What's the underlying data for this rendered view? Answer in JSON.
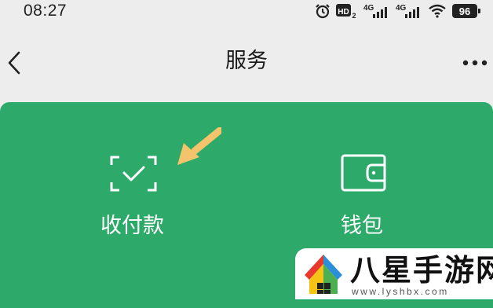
{
  "status_bar": {
    "time": "08:27",
    "icons": [
      "alarm-icon",
      "hd-icon",
      "signal-4g-icon",
      "signal-4g-icon",
      "wifi-icon",
      "battery-icon"
    ],
    "hd_label": "HD",
    "hd_sub": "2",
    "network_label": "4G",
    "battery": "96"
  },
  "nav": {
    "title": "服务",
    "back_icon": "chevron-left-icon",
    "more_icon": "more-dots-icon"
  },
  "services": {
    "background_color": "#2daa6a",
    "items": [
      {
        "label": "收付款",
        "icon": "scan-check-icon"
      },
      {
        "label": "钱包",
        "icon": "wallet-icon"
      }
    ],
    "pointer_icon": "arrow-pointer-icon",
    "pointer_color": "#f3c46b"
  },
  "watermark": {
    "title": "八星手游网",
    "domain": "www.lyshbx.com"
  }
}
